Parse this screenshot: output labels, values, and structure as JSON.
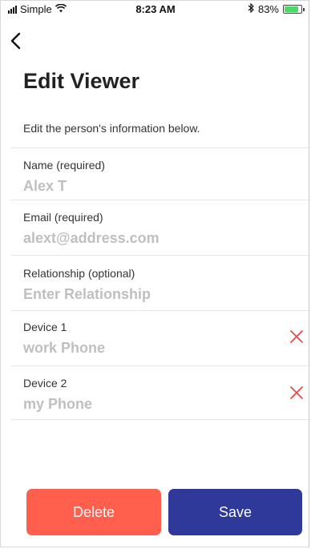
{
  "status_bar": {
    "carrier": "Simple",
    "time": "8:23 AM",
    "battery_percent": "83%",
    "battery_level": 0.83
  },
  "header": {
    "title": "Edit Viewer",
    "subtitle": "Edit the person's information below."
  },
  "fields": [
    {
      "label": "Name (required)",
      "value": "Alex T"
    },
    {
      "label": "Email (required)",
      "value": "alext@address.com"
    },
    {
      "label": "Relationship (optional)",
      "placeholder": "Enter Relationship"
    }
  ],
  "devices": [
    {
      "label": "Device 1",
      "value": "work Phone"
    },
    {
      "label": "Device 2",
      "value": "my Phone"
    }
  ],
  "actions": {
    "delete_label": "Delete",
    "save_label": "Save"
  },
  "colors": {
    "delete": "#ff5f4c",
    "save": "#2e399a",
    "remove_icon": "#e84a4a"
  },
  "icons": [
    "back-chevron-icon",
    "signal-icon",
    "wifi-icon",
    "bluetooth-icon",
    "battery-icon",
    "remove-x-icon"
  ]
}
